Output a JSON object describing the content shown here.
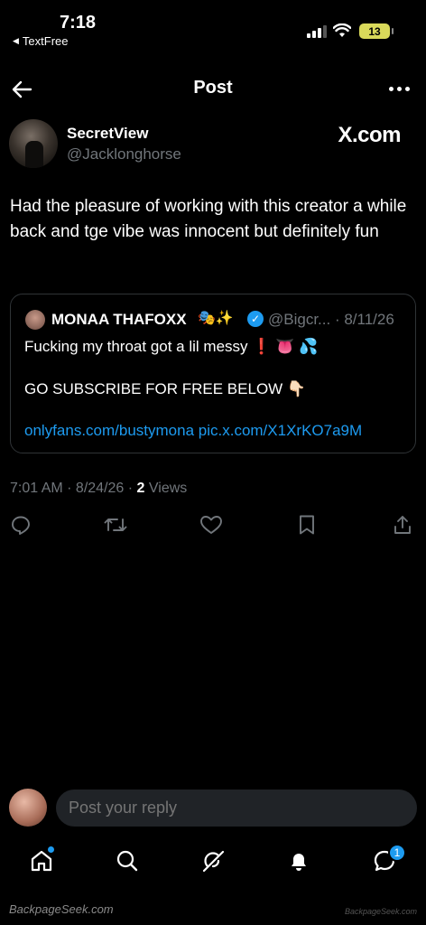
{
  "status_bar": {
    "time": "7:18",
    "back_app": "TextFree",
    "battery": "13"
  },
  "header": {
    "title": "Post"
  },
  "author": {
    "name": "SecretView",
    "handle": "@Jacklonghorse",
    "brand": "X.com"
  },
  "tweet": {
    "text": "Had the pleasure of working with this creator a while back and tge vibe was innocent but definitely fun"
  },
  "quote": {
    "name": "MONAA THAFOXX",
    "name_emoji": "🎭✨",
    "handle_date": "@Bigcr... · 8/11/26",
    "line1": "Fucking my throat got a lil messy ❗ 👅 💦",
    "line2": "GO SUBSCRIBE FOR FREE BELOW 👇🏻",
    "link": "onlyfans.com/bustymona pic.x.com/X1XrKO7a9M"
  },
  "meta": {
    "time_date": "7:01 AM · 8/24/26 · ",
    "views_count": "2",
    "views_label": " Views"
  },
  "reply": {
    "placeholder": "Post your reply"
  },
  "nav": {
    "messages_badge": "1"
  },
  "watermarks": {
    "left": "BackpageSeek.com",
    "right": "BackpageSeek.com"
  },
  "colors": {
    "accent": "#1d9bf0",
    "muted": "#71767b",
    "border": "#2f3336",
    "input_bg": "#202327"
  },
  "icons": [
    "back-arrow-icon",
    "more-icon",
    "reply-icon",
    "repost-icon",
    "like-icon",
    "bookmark-icon",
    "share-icon",
    "home-icon",
    "search-icon",
    "grok-icon",
    "notifications-icon",
    "messages-icon"
  ]
}
